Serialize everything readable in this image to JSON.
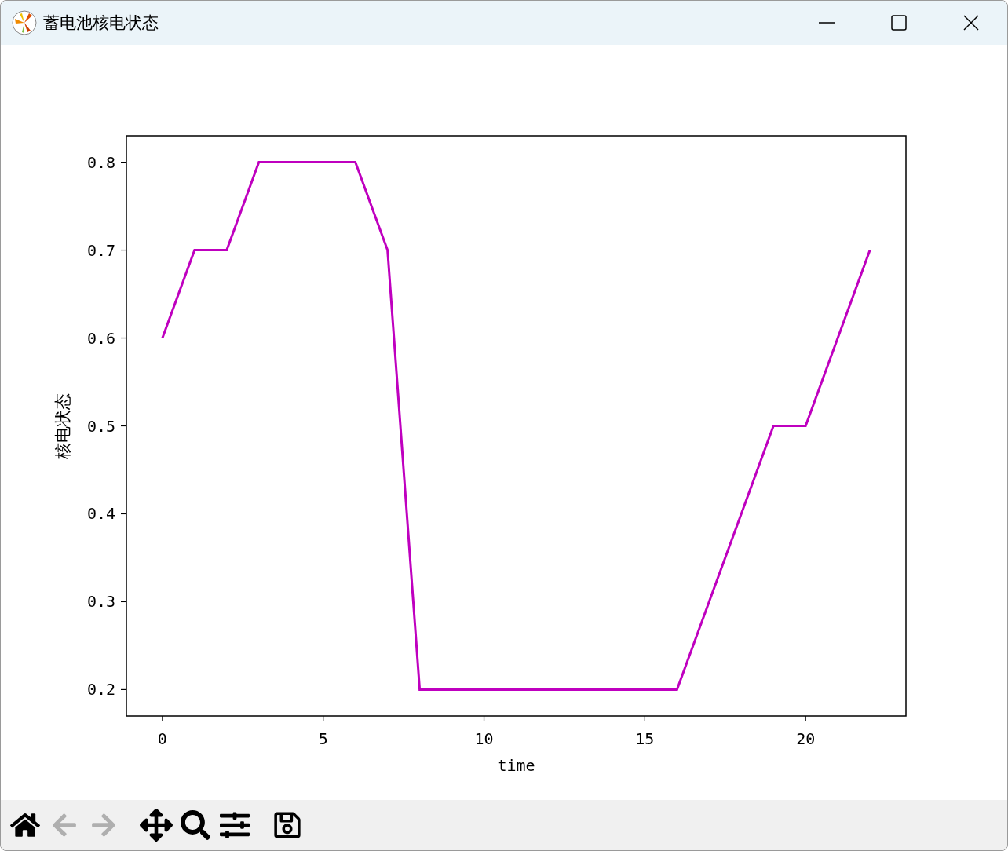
{
  "window": {
    "title": "蓄电池核电状态"
  },
  "figure": {
    "chart_data": {
      "type": "line",
      "xlabel": "time",
      "ylabel": "核电状态",
      "x": [
        0,
        1,
        2,
        3,
        4,
        5,
        6,
        7,
        8,
        9,
        10,
        11,
        12,
        13,
        14,
        15,
        16,
        17,
        18,
        19,
        20,
        21,
        22
      ],
      "series": [
        {
          "color": "#bf00bf",
          "values": [
            0.6,
            0.7,
            0.7,
            0.8,
            0.8,
            0.8,
            0.8,
            0.7,
            0.2,
            0.2,
            0.2,
            0.2,
            0.2,
            0.2,
            0.2,
            0.2,
            0.2,
            0.3,
            0.4,
            0.5,
            0.5,
            0.6,
            0.7
          ]
        }
      ],
      "xlim": [
        -1.12,
        23.12
      ],
      "ylim": [
        0.17,
        0.83
      ],
      "xticks": [
        0,
        5,
        10,
        15,
        20
      ],
      "yticks": [
        {
          "value": 0.2,
          "label": "0.2"
        },
        {
          "value": 0.3,
          "label": "0.3"
        },
        {
          "value": 0.4,
          "label": "0.4"
        },
        {
          "value": 0.5,
          "label": "0.5"
        },
        {
          "value": 0.6,
          "label": "0.6"
        },
        {
          "value": 0.7,
          "label": "0.7"
        },
        {
          "value": 0.8,
          "label": "0.8"
        }
      ]
    }
  },
  "toolbar": [
    {
      "kind": "home",
      "disabled": false
    },
    {
      "kind": "back",
      "disabled": true
    },
    {
      "kind": "forward",
      "disabled": true
    },
    {
      "kind": "separator"
    },
    {
      "kind": "pan",
      "disabled": false
    },
    {
      "kind": "zoom",
      "disabled": false
    },
    {
      "kind": "configure",
      "disabled": false
    },
    {
      "kind": "separator"
    },
    {
      "kind": "save",
      "disabled": false
    }
  ]
}
